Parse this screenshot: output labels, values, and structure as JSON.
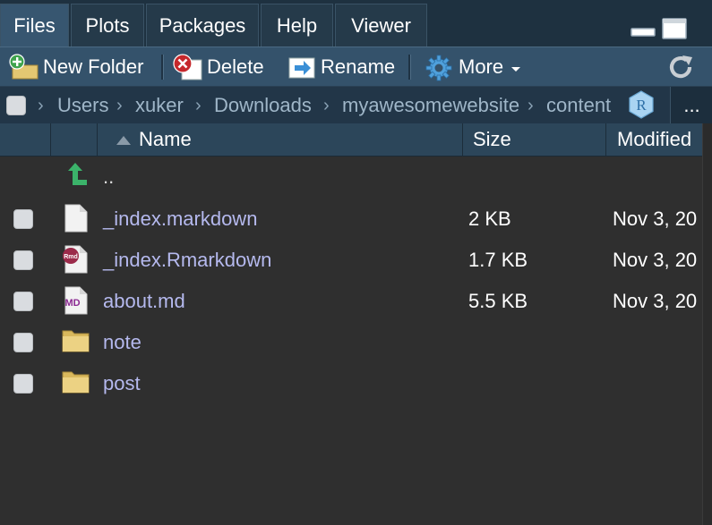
{
  "tabs": [
    {
      "label": "Files",
      "active": true
    },
    {
      "label": "Plots",
      "active": false
    },
    {
      "label": "Packages",
      "active": false
    },
    {
      "label": "Help",
      "active": false
    },
    {
      "label": "Viewer",
      "active": false
    }
  ],
  "toolbar": {
    "new_folder_label": "New Folder",
    "delete_label": "Delete",
    "rename_label": "Rename",
    "more_label": "More"
  },
  "breadcrumb": {
    "items": [
      "Users",
      "xuker",
      "Downloads",
      "myawesomewebsite",
      "content"
    ],
    "overflow_label": "..."
  },
  "columns": {
    "name": "Name",
    "size": "Size",
    "modified": "Modified"
  },
  "parent_dir_label": "..",
  "files": [
    {
      "name": "_index.markdown",
      "size": "2 KB",
      "modified": "Nov 3, 20",
      "icon": "document-icon"
    },
    {
      "name": "_index.Rmarkdown",
      "size": "1.7 KB",
      "modified": "Nov 3, 20",
      "icon": "rmd-file-icon"
    },
    {
      "name": "about.md",
      "size": "5.5 KB",
      "modified": "Nov 3, 20",
      "icon": "md-file-icon"
    },
    {
      "name": "note",
      "size": "",
      "modified": "",
      "icon": "folder-icon"
    },
    {
      "name": "post",
      "size": "",
      "modified": "",
      "icon": "folder-icon"
    }
  ],
  "colors": {
    "accent": "#375670",
    "file_link": "#b5b9ee",
    "background": "#2f2f2f"
  }
}
